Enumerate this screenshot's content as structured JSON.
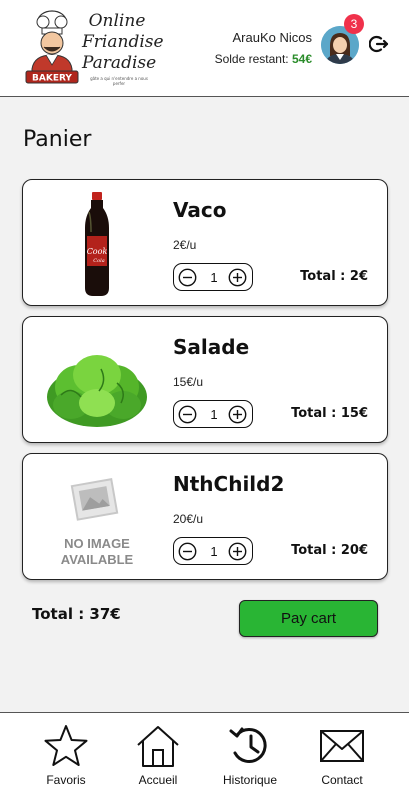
{
  "header": {
    "logo_lines": [
      "Online",
      "Friandise",
      "Paradise"
    ],
    "logo_badge": "BAKERY",
    "logo_tagline": "gâte a qui n'entendre a nous perfer",
    "user_name": "ArauKo Nicos",
    "balance_label": "Solde restant:",
    "balance_value": "54€",
    "notification_count": "3"
  },
  "page": {
    "title": "Panier"
  },
  "cart": {
    "items": [
      {
        "name": "Vaco",
        "unit_price": "2€/u",
        "quantity": "1",
        "total": "Total : 2€",
        "image": "cola-bottle"
      },
      {
        "name": "Salade",
        "unit_price": "15€/u",
        "quantity": "1",
        "total": "Total : 15€",
        "image": "lettuce"
      },
      {
        "name": "NthChild2",
        "unit_price": "20€/u",
        "quantity": "1",
        "total": "Total : 20€",
        "image": "no-image",
        "no_image_line1": "NO IMAGE",
        "no_image_line2": "AVAILABLE"
      }
    ],
    "grand_total": "Total : 37€",
    "pay_label": "Pay cart"
  },
  "nav": {
    "items": [
      {
        "label": "Favoris",
        "icon": "star-icon"
      },
      {
        "label": "Accueil",
        "icon": "home-icon"
      },
      {
        "label": "Historique",
        "icon": "history-icon"
      },
      {
        "label": "Contact",
        "icon": "mail-icon"
      }
    ]
  },
  "colors": {
    "accent_green": "#29b534",
    "balance_green": "#2a8c2a",
    "badge_red": "#f0314b"
  }
}
